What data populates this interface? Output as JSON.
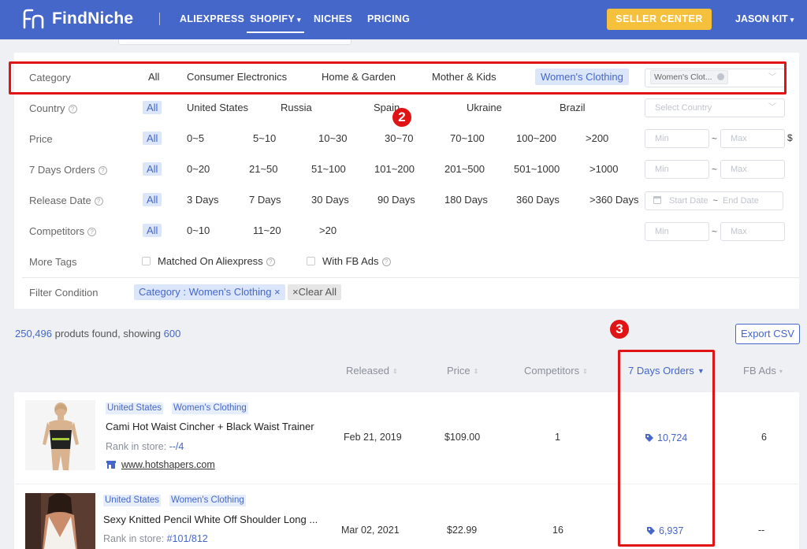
{
  "nav": {
    "logo": "FindNiche",
    "items": [
      "ALIEXPRESS",
      "SHOPIFY",
      "NICHES",
      "PRICING"
    ],
    "seller_center": "SELLER CENTER",
    "user": "JASON KIT"
  },
  "filters": {
    "category": {
      "label": "Category",
      "options": [
        "All",
        "Consumer Electronics",
        "Home & Garden",
        "Mother & Kids",
        "Women's Clothing"
      ],
      "selected_value": "Women's Clot..."
    },
    "country": {
      "label": "Country",
      "options": [
        "All",
        "United States",
        "Russia",
        "Spain",
        "Ukraine",
        "Brazil"
      ],
      "placeholder": "Select Country"
    },
    "price": {
      "label": "Price",
      "options": [
        "All",
        "0~5",
        "5~10",
        "10~30",
        "30~70",
        "70~100",
        "100~200",
        ">200"
      ],
      "min": "Min",
      "max": "Max",
      "unit": "$"
    },
    "orders": {
      "label": "7 Days Orders",
      "options": [
        "All",
        "0~20",
        "21~50",
        "51~100",
        "101~200",
        "201~500",
        "501~1000",
        ">1000"
      ],
      "min": "Min",
      "max": "Max"
    },
    "release": {
      "label": "Release Date",
      "options": [
        "All",
        "3 Days",
        "7 Days",
        "30 Days",
        "90 Days",
        "180 Days",
        "360 Days",
        ">360 Days"
      ],
      "start": "Start Date",
      "end": "End Date"
    },
    "competitors": {
      "label": "Competitors",
      "options": [
        "All",
        "0~10",
        "11~20",
        ">20"
      ],
      "min": "Min",
      "max": "Max"
    },
    "more_tags": {
      "label": "More Tags",
      "options": [
        "Matched On Aliexpress",
        "With FB Ads"
      ]
    },
    "condition": {
      "label": "Filter Condition",
      "active_tag": "Category : Women's Clothing ×",
      "clear": "×Clear All"
    }
  },
  "annotations": {
    "badge_2": "2",
    "badge_3": "3"
  },
  "results": {
    "count": "250,496",
    "text": " produts found, showing ",
    "showing": "600",
    "export": "Export CSV",
    "columns": [
      "Released",
      "Price",
      "Competitors",
      "7 Days Orders",
      "FB Ads"
    ],
    "rows": [
      {
        "country": "United States",
        "category": "Women's Clothing",
        "name": "Cami Hot Waist Cincher + Black Waist Trainer",
        "rank_label": "Rank in store: ",
        "rank": "--/4",
        "store": "www.hotshapers.com",
        "released": "Feb 21, 2019",
        "price": "$109.00",
        "competitors": "1",
        "orders": "10,724",
        "fb_ads": "6"
      },
      {
        "country": "United States",
        "category": "Women's Clothing",
        "name": "Sexy Knitted Pencil White Off Shoulder Long ...",
        "rank_label": "Rank in store: ",
        "rank": "#101/812",
        "released": "Mar 02, 2021",
        "price": "$22.99",
        "competitors": "16",
        "orders": "6,937",
        "fb_ads": "--"
      }
    ]
  }
}
